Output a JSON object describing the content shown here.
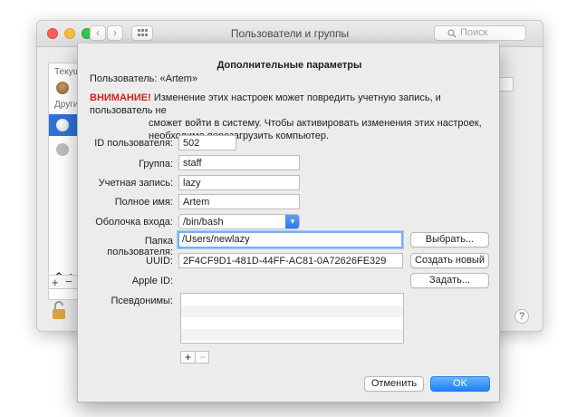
{
  "window": {
    "title": "Пользователи и группы",
    "search_placeholder": "Поиск",
    "sidebar_header_current": "Текущ",
    "sidebar_header_other": "Други",
    "sidebar_home_letter": "f"
  },
  "sheet": {
    "title": "Дополнительные параметры",
    "user_line": "Пользователь:  «Artem»",
    "warning_label": "ВНИМАНИЕ!",
    "warning_text_1": "Изменение этих настроек может повредить учетную запись, и пользователь не",
    "warning_text_2": "сможет войти в систему. Чтобы активировать изменения этих настроек,",
    "warning_text_3": "необходимо перезагрузить компьютер.",
    "fields": {
      "user_id_label": "ID пользователя:",
      "user_id_value": "502",
      "group_label": "Группа:",
      "group_value": "staff",
      "account_label": "Учетная запись:",
      "account_value": "lazy",
      "full_name_label": "Полное имя:",
      "full_name_value": "Artem",
      "shell_label": "Оболочка входа:",
      "shell_value": "/bin/bash",
      "home_label": "Папка пользователя:",
      "home_value": "/Users/newlazy",
      "uuid_label": "UUID:",
      "uuid_value": "2F4CF9D1-481D-44FF-AC81-0A72626FE329",
      "apple_id_label": "Apple ID:",
      "aliases_label": "Псевдонимы:"
    },
    "buttons": {
      "choose": "Выбрать...",
      "create_new": "Создать новый",
      "set": "Задать...",
      "cancel": "Отменить",
      "ok": "OK",
      "add": "+",
      "remove": "−"
    }
  },
  "colors": {
    "warning": "#d6201b",
    "accent": "#1a82fb",
    "selection": "#2f73d8"
  }
}
